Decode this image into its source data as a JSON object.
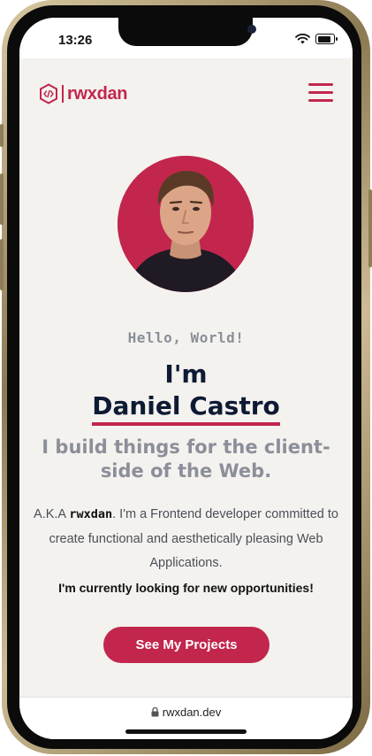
{
  "status_bar": {
    "time": "13:26"
  },
  "header": {
    "logo_text": "rwxdan",
    "logo_icon": "code-hexagon-icon",
    "menu_icon": "hamburger-menu-icon"
  },
  "hero": {
    "greeting": "Hello, World!",
    "im": "I'm",
    "name": "Daniel Castro",
    "tagline": "I build things for the client-side of the Web.",
    "desc_prefix": "A.K.A ",
    "desc_handle": "rwxdan",
    "desc_rest": ". I'm a Frontend developer committed to create functional and aesthetically pleasing Web Applications.",
    "desc_strong": "I'm currently looking for new opportunities!",
    "cta_label": "See My Projects"
  },
  "browser": {
    "url": "rwxdan.dev"
  },
  "colors": {
    "accent": "#c2264d",
    "navy": "#0e1a33",
    "background": "#f4f2ef"
  }
}
